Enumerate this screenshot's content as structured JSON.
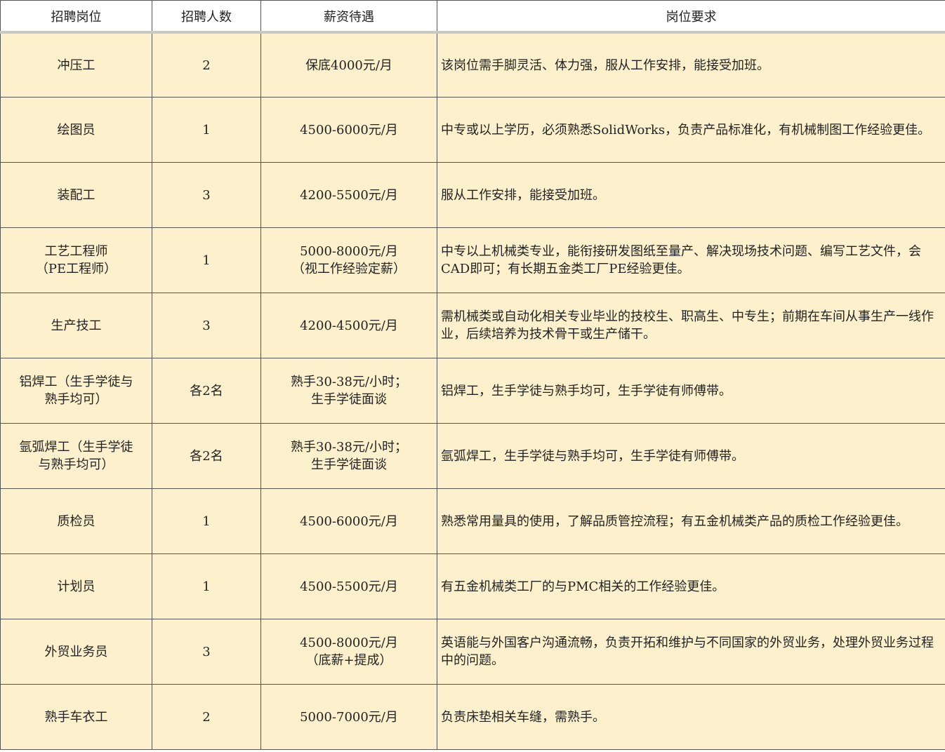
{
  "headers": [
    "招聘岗位",
    "招聘人数",
    "薪资待遇",
    "岗位要求"
  ],
  "rows": [
    {
      "position": [
        "冲压工"
      ],
      "count": "2",
      "salary": [
        "保底4000元/月"
      ],
      "requirement": "该岗位需手脚灵活、体力强，服从工作安排，能接受加班。"
    },
    {
      "position": [
        "绘图员"
      ],
      "count": "1",
      "salary": [
        "4500-6000元/月"
      ],
      "requirement": "中专或以上学历，必须熟悉SolidWorks，负责产品标准化，有机械制图工作经验更佳。"
    },
    {
      "position": [
        "装配工"
      ],
      "count": "3",
      "salary": [
        "4200-5500元/月"
      ],
      "requirement": "服从工作安排，能接受加班。"
    },
    {
      "position": [
        "工艺工程师",
        "（PE工程师）"
      ],
      "count": "1",
      "salary": [
        "5000-8000元/月",
        "（视工作经验定薪）"
      ],
      "requirement": "中专以上机械类专业，能衔接研发图纸至量产、解决现场技术问题、编写工艺文件，会CAD即可；有长期五金类工厂PE经验更佳。"
    },
    {
      "position": [
        "生产技工"
      ],
      "count": "3",
      "salary": [
        "4200-4500元/月"
      ],
      "requirement": "需机械类或自动化相关专业毕业的技校生、职高生、中专生；前期在车间从事生产一线作业，后续培养为技术骨干或生产储干。"
    },
    {
      "position": [
        "铝焊工（生手学徒与",
        "熟手均可）"
      ],
      "count": "各2名",
      "salary": [
        "熟手30-38元/小时；",
        "生手学徒面谈"
      ],
      "requirement": "铝焊工，生手学徒与熟手均可，生手学徒有师傅带。"
    },
    {
      "position": [
        "氩弧焊工（生手学徒",
        "与熟手均可）"
      ],
      "count": "各2名",
      "salary": [
        "熟手30-38元/小时；",
        "生手学徒面谈"
      ],
      "requirement": "氩弧焊工，生手学徒与熟手均可，生手学徒有师傅带。"
    },
    {
      "position": [
        "质检员"
      ],
      "count": "1",
      "salary": [
        "4500-6000元/月"
      ],
      "requirement": "熟悉常用量具的使用，了解品质管控流程；有五金机械类产品的质检工作经验更佳。"
    },
    {
      "position": [
        "计划员"
      ],
      "count": "1",
      "salary": [
        "4500-5500元/月"
      ],
      "requirement": "有五金机械类工厂的与PMC相关的工作经验更佳。"
    },
    {
      "position": [
        "外贸业务员"
      ],
      "count": "3",
      "salary": [
        "4500-8000元/月",
        "（底薪+提成）"
      ],
      "requirement": "英语能与外国客户沟通流畅，负责开拓和维护与不同国家的外贸业务，处理外贸业务过程中的问题。"
    },
    {
      "position": [
        "熟手车衣工"
      ],
      "count": "2",
      "salary": [
        "5000-7000元/月"
      ],
      "requirement": "负责床垫相关车缝，需熟手。"
    }
  ],
  "colors": {
    "header_bg": "#ffffff",
    "row_bg": "#fdf1cd",
    "border": "#555555"
  }
}
